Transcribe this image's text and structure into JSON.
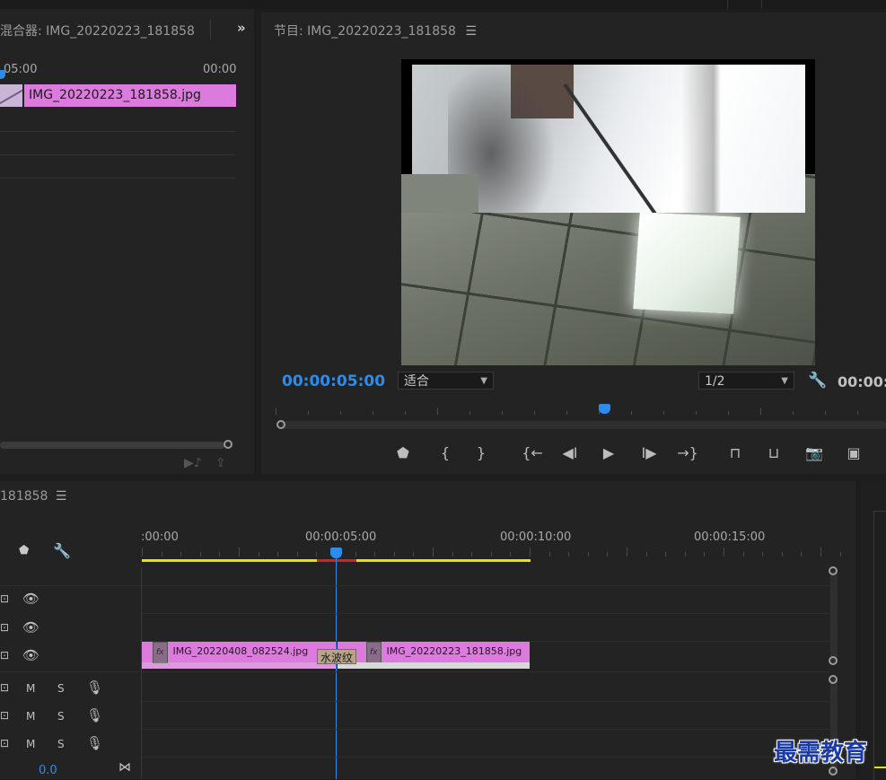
{
  "source_panel": {
    "title": "混合器: IMG_20220223_181858",
    "expand_icon": "double-chevron-right-icon",
    "ruler_left": "05:00",
    "ruler_right": "00:00",
    "clip_label": "IMG_20220223_181858.jpg"
  },
  "program_monitor": {
    "title": "节目: IMG_20220223_181858",
    "timecode": "00:00:05:00",
    "fit_select": "适合",
    "resolution_select": "1/2",
    "timecode_right": "00:00:"
  },
  "timeline": {
    "title": "181858",
    "ruler_labels": [
      ":00:00",
      "00:00:05:00",
      "00:00:10:00",
      "00:00:15:00"
    ],
    "video_clip_1": "IMG_20220408_082524.jpg",
    "video_clip_2": "IMG_20220223_181858.jpg",
    "transition_label": "水波纹",
    "audio_track_buttons": {
      "mute": "M",
      "solo": "S"
    },
    "volume_value": "0.0"
  },
  "watermark": "最需教育",
  "colors": {
    "accent_blue": "#2d8ceb",
    "clip_pink": "#dd7add",
    "work_area_yellow": "#e6e600",
    "render_red": "#c8262b"
  }
}
